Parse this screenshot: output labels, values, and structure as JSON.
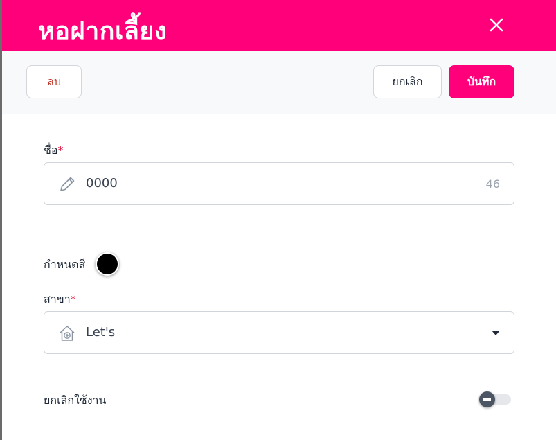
{
  "dialog": {
    "title": "หอฝากเลี้ยง",
    "close_icon": "close-icon"
  },
  "toolbar": {
    "delete_label": "ลบ",
    "cancel_label": "ยกเลิก",
    "save_label": "บันทึก"
  },
  "form": {
    "name": {
      "label": "ชื่อ",
      "required_mark": "*",
      "value": "0000",
      "remaining": "46",
      "icon": "pencil-icon"
    },
    "color": {
      "label": "กำหนดสี",
      "value": "#000000"
    },
    "branch": {
      "label": "สาขา",
      "required_mark": "*",
      "value": "Let's",
      "icon": "clinic-house-icon"
    },
    "deactivate": {
      "label": "ยกเลิกใช้งาน",
      "enabled": false
    }
  },
  "colors": {
    "brand": "#ff007a",
    "delete_text": "#c0392b"
  }
}
